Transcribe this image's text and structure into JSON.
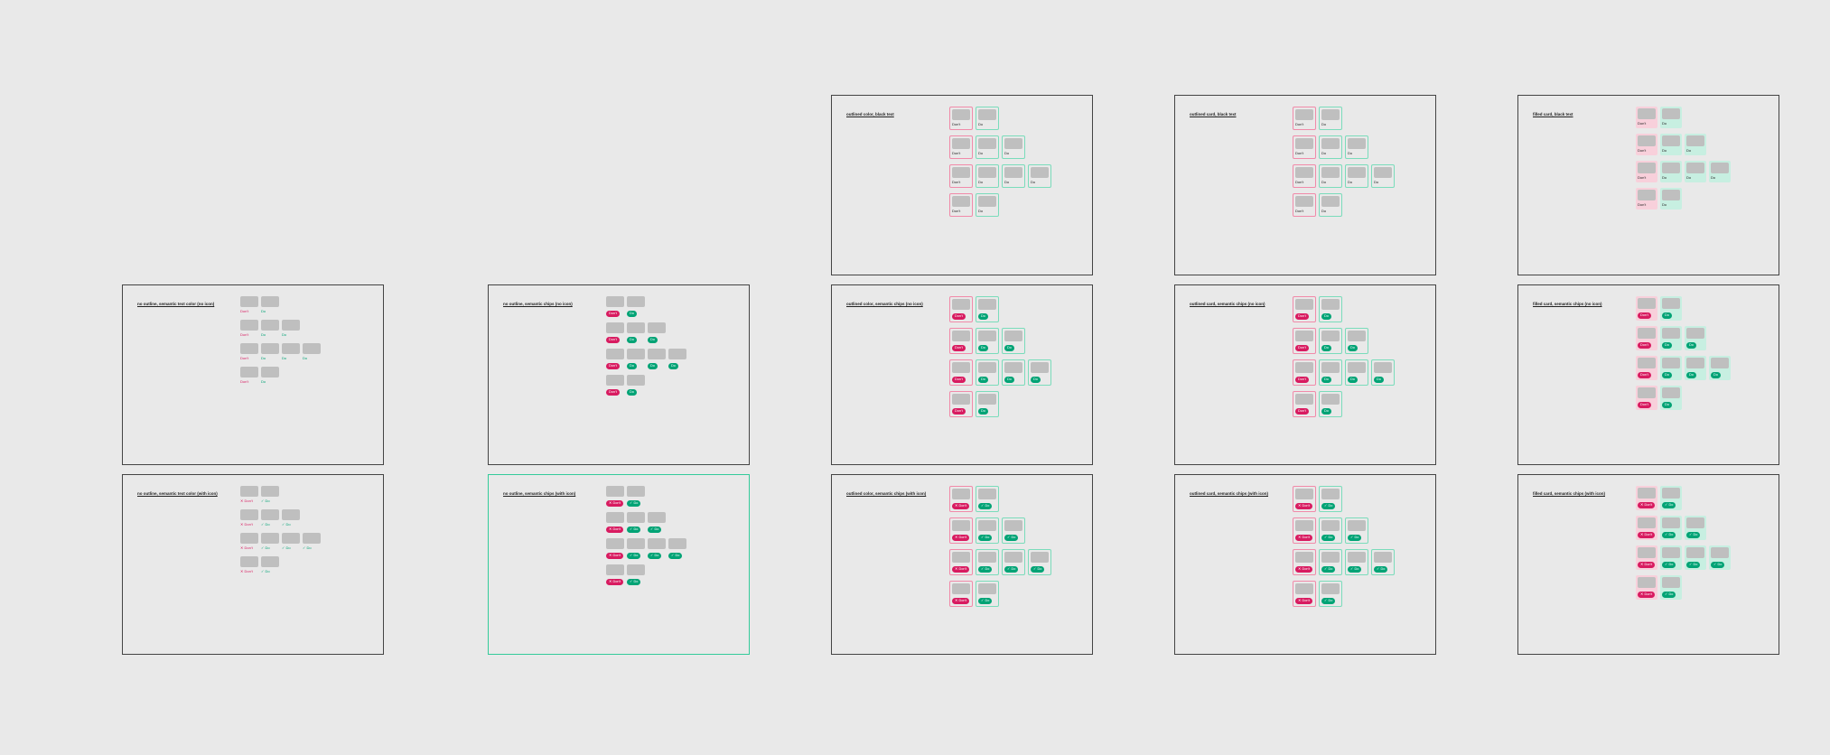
{
  "labels": {
    "dont": "Don't",
    "do": "Do"
  },
  "rows": [
    [
      "dont",
      "do"
    ],
    [
      "dont",
      "do",
      "do"
    ],
    [
      "dont",
      "do",
      "do",
      "do"
    ],
    [
      "dont",
      "do"
    ]
  ],
  "frames": [
    {
      "id": "c1r2",
      "col": 1,
      "row": 2,
      "title": "no outline, semantic text color (no icon)",
      "style": "none",
      "label": "text",
      "icon": false,
      "selected": false
    },
    {
      "id": "c1r3",
      "col": 1,
      "row": 3,
      "title": "no outline, semantic text color (with icon)",
      "style": "none",
      "label": "text",
      "icon": true,
      "selected": false
    },
    {
      "id": "c2r2",
      "col": 2,
      "row": 2,
      "title": "no outline, semantic chips (no icon)",
      "style": "none",
      "label": "chip",
      "icon": false,
      "selected": false
    },
    {
      "id": "c2r3",
      "col": 2,
      "row": 3,
      "title": "no outline, semantic chips (with icon)",
      "style": "none",
      "label": "chip",
      "icon": true,
      "selected": true
    },
    {
      "id": "c3r1",
      "col": 3,
      "row": 1,
      "title": "outlined color, black text",
      "style": "outlined",
      "label": "black",
      "icon": false,
      "selected": false
    },
    {
      "id": "c3r2",
      "col": 3,
      "row": 2,
      "title": "outlined color, semantic chips (no icon)",
      "style": "outlined",
      "label": "chip",
      "icon": false,
      "selected": false
    },
    {
      "id": "c3r3",
      "col": 3,
      "row": 3,
      "title": "outlined color, semantic chips (with icon)",
      "style": "outlined",
      "label": "chip",
      "icon": true,
      "selected": false
    },
    {
      "id": "c4r1",
      "col": 4,
      "row": 1,
      "title": "outlined card, black text",
      "style": "outlined",
      "label": "black",
      "icon": false,
      "selected": false
    },
    {
      "id": "c4r2",
      "col": 4,
      "row": 2,
      "title": "outlined card, semantic chips (no icon)",
      "style": "outlined",
      "label": "chip",
      "icon": false,
      "selected": false
    },
    {
      "id": "c4r3",
      "col": 4,
      "row": 3,
      "title": "outlined card, semantic chips (with icon)",
      "style": "outlined",
      "label": "chip",
      "icon": true,
      "selected": false
    },
    {
      "id": "c5r1",
      "col": 5,
      "row": 1,
      "title": "filled card, black text",
      "style": "filled",
      "label": "black",
      "icon": false,
      "selected": false
    },
    {
      "id": "c5r2",
      "col": 5,
      "row": 2,
      "title": "filled card, semantic chips (no icon)",
      "style": "filled",
      "label": "chip",
      "icon": false,
      "selected": false
    },
    {
      "id": "c5r3",
      "col": 5,
      "row": 3,
      "title": "filled card, semantic chips (with icon)",
      "style": "filled",
      "label": "chip",
      "icon": true,
      "selected": false
    }
  ],
  "layout": {
    "colX": {
      "1": 135,
      "2": 540,
      "3": 920,
      "4": 1300,
      "5": 1680
    },
    "rowY": {
      "1": 105,
      "2": 315,
      "3": 525
    }
  }
}
